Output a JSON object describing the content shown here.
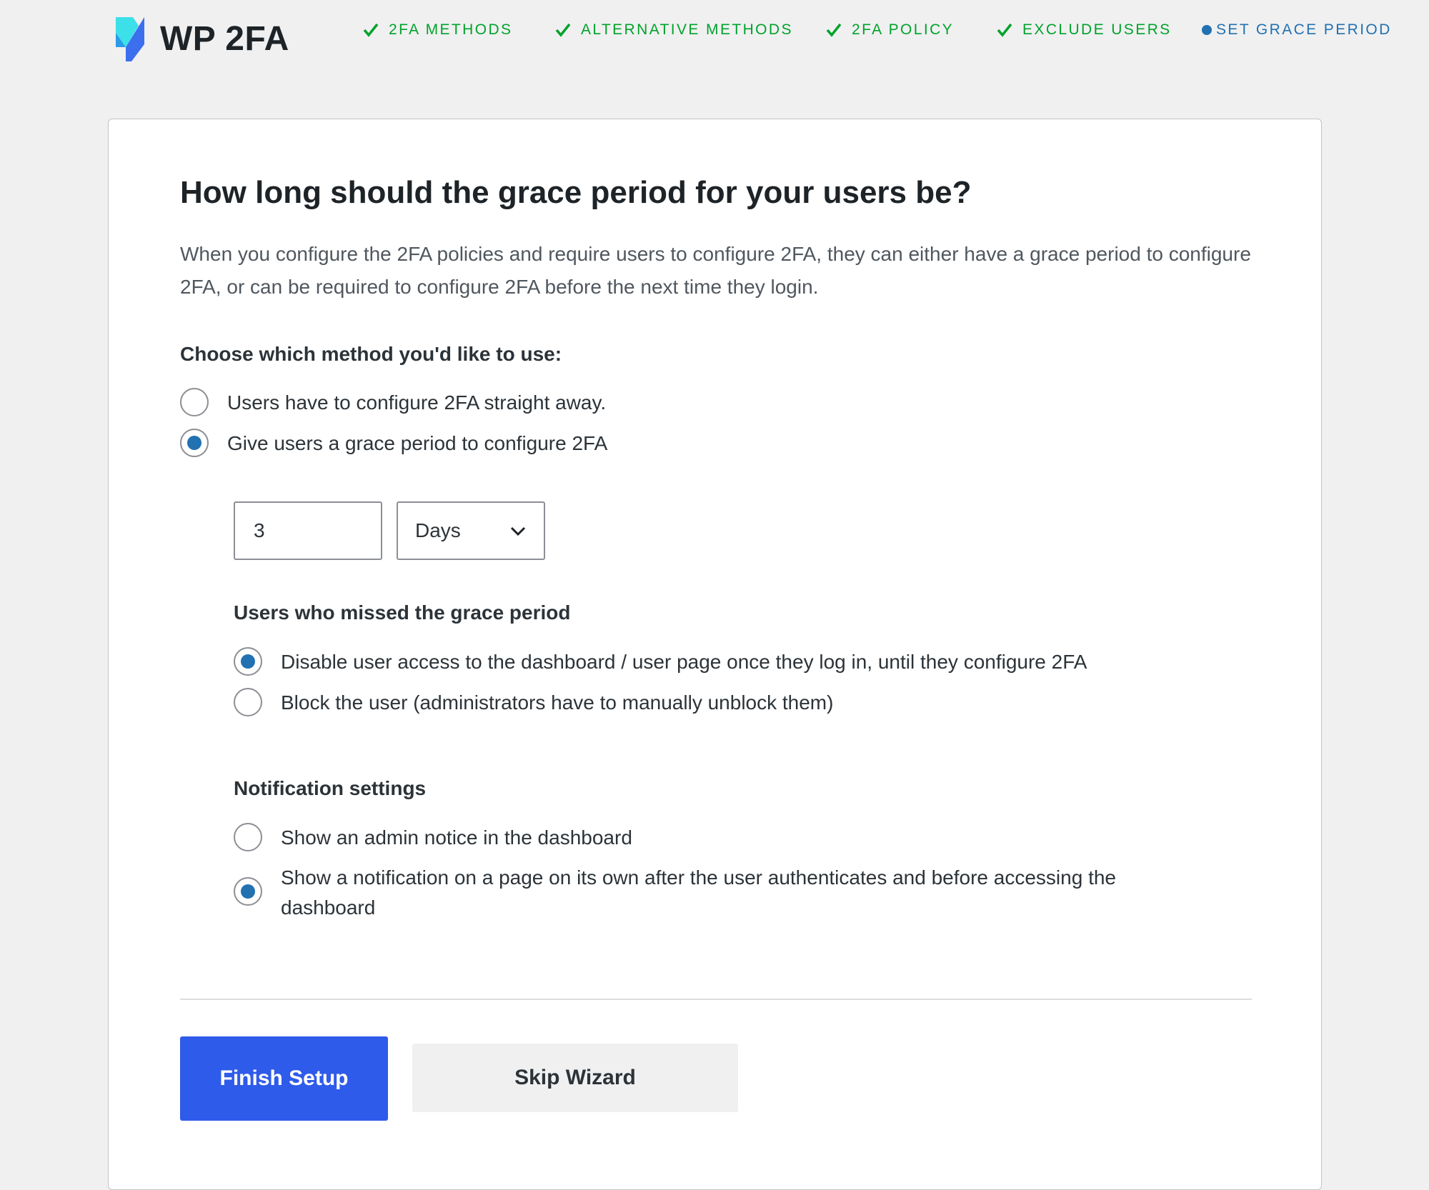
{
  "header": {
    "logo_text": "WP 2FA",
    "steps": [
      {
        "label": "2FA METHODS",
        "status": "complete"
      },
      {
        "label": "ALTERNATIVE METHODS",
        "status": "complete"
      },
      {
        "label": "2FA POLICY",
        "status": "complete"
      },
      {
        "label": "EXCLUDE USERS",
        "status": "complete"
      },
      {
        "label": "SET GRACE PERIOD",
        "status": "current"
      }
    ]
  },
  "main": {
    "title": "How long should the grace period for your users be?",
    "description": "When you configure the 2FA policies and require users to configure 2FA, they can either have a grace period to configure 2FA, or can be required to configure 2FA before the next time they login.",
    "method_label": "Choose which method you'd like to use:",
    "method_options": [
      {
        "label": "Users have to configure 2FA straight away.",
        "selected": false
      },
      {
        "label": "Give users a grace period to configure 2FA",
        "selected": true
      }
    ],
    "grace_period": {
      "value": "3",
      "unit": "Days"
    },
    "missed_label": "Users who missed the grace period",
    "missed_options": [
      {
        "label": "Disable user access to the dashboard / user page once they log in, until they configure 2FA",
        "selected": true
      },
      {
        "label": "Block the user (administrators have to manually unblock them)",
        "selected": false
      }
    ],
    "notification_label": "Notification settings",
    "notification_options": [
      {
        "label": "Show an admin notice in the dashboard",
        "selected": false
      },
      {
        "label": "Show a notification on a page on its own after the user authenticates and before accessing the dashboard",
        "selected": true
      }
    ]
  },
  "actions": {
    "finish_label": "Finish Setup",
    "skip_label": "Skip Wizard"
  },
  "colors": {
    "accent": "#2271b1",
    "complete": "#00a32a",
    "primary_button": "#2f5bea"
  }
}
